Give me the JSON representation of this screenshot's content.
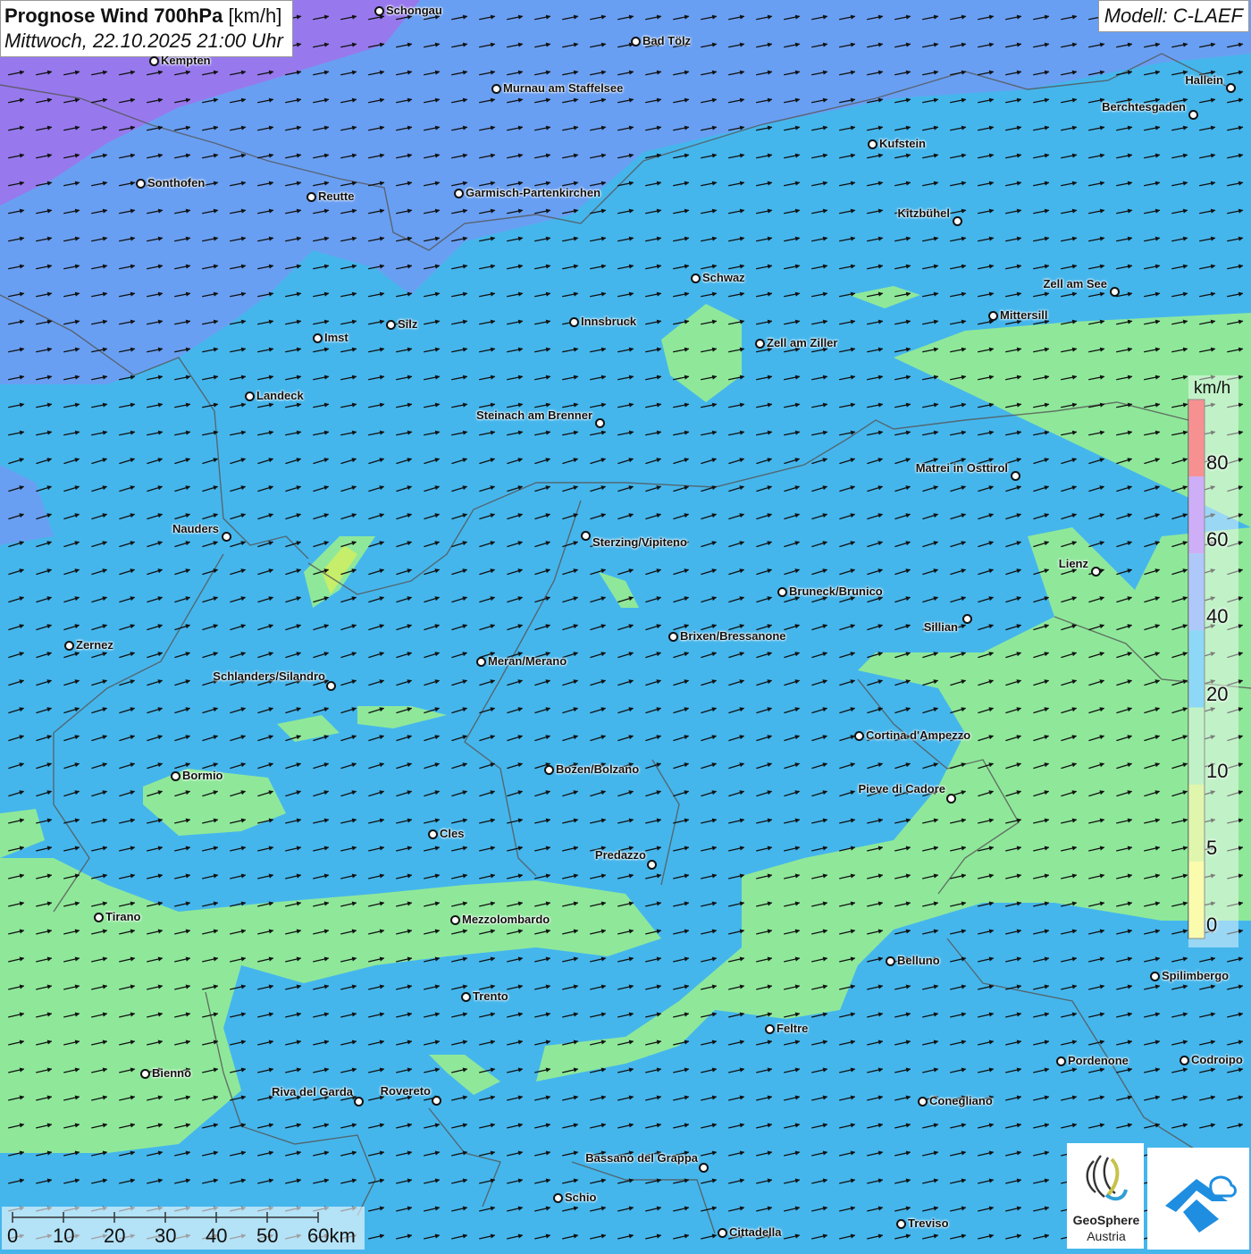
{
  "title": {
    "main_bold": "Prognose Wind 700hPa",
    "main_unit": "[km/h]",
    "date": "Mittwoch, 22.10.2025 21:00 Uhr"
  },
  "model": "Modell: C-LAEF",
  "legend": {
    "unit": "km/h",
    "labels": [
      "80",
      "60",
      "40",
      "20",
      "10",
      "5",
      "0"
    ],
    "colors": [
      "#f03838",
      "#a56cf0",
      "#6a9cf5",
      "#2fb8ef",
      "#8fe89a",
      "#c6ee6a",
      "#f7f76a"
    ]
  },
  "scalebar": {
    "ticks": [
      "0",
      "10",
      "20",
      "30",
      "40",
      "50",
      "60km"
    ]
  },
  "logos": {
    "geosphere_line1": "GeoSphere",
    "geosphere_line2": "Austria"
  },
  "cities": [
    {
      "name": "Schongau"
    },
    {
      "name": "Bad Tölz"
    },
    {
      "name": "Kempten"
    },
    {
      "name": "Murnau am Staffelsee"
    },
    {
      "name": "Hallein"
    },
    {
      "name": "Berchtesgaden"
    },
    {
      "name": "Kufstein"
    },
    {
      "name": "Sonthofen"
    },
    {
      "name": "Reutte"
    },
    {
      "name": "Garmisch-Partenkirchen"
    },
    {
      "name": "Kitzbühel"
    },
    {
      "name": "Schwaz"
    },
    {
      "name": "Zell am See"
    },
    {
      "name": "Mittersill"
    },
    {
      "name": "Innsbruck"
    },
    {
      "name": "Silz"
    },
    {
      "name": "Imst"
    },
    {
      "name": "Zell am Ziller"
    },
    {
      "name": "Landeck"
    },
    {
      "name": "Steinach am Brenner"
    },
    {
      "name": "Matrei in Osttirol"
    },
    {
      "name": "Nauders"
    },
    {
      "name": "Sterzing/Vipiteno"
    },
    {
      "name": "Lienz"
    },
    {
      "name": "Bruneck/Brunico"
    },
    {
      "name": "Sillian"
    },
    {
      "name": "Zernez"
    },
    {
      "name": "Brixen/Bressanone"
    },
    {
      "name": "Meran/Merano"
    },
    {
      "name": "Schlanders/Silandro"
    },
    {
      "name": "Cortina d'Ampezzo"
    },
    {
      "name": "Bozen/Bolzano"
    },
    {
      "name": "Bormio"
    },
    {
      "name": "Pieve di Cadore"
    },
    {
      "name": "Cles"
    },
    {
      "name": "Predazzo"
    },
    {
      "name": "Tirano"
    },
    {
      "name": "Mezzolombardo"
    },
    {
      "name": "Belluno"
    },
    {
      "name": "Spilimbergo"
    },
    {
      "name": "Trento"
    },
    {
      "name": "Feltre"
    },
    {
      "name": "Pordenone"
    },
    {
      "name": "Codroipo"
    },
    {
      "name": "Bienno"
    },
    {
      "name": "Riva del Garda"
    },
    {
      "name": "Rovereto"
    },
    {
      "name": "Conegliano"
    },
    {
      "name": "Bassano del Grappa"
    },
    {
      "name": "Schio"
    },
    {
      "name": "Treviso"
    },
    {
      "name": "Cittadella"
    }
  ]
}
